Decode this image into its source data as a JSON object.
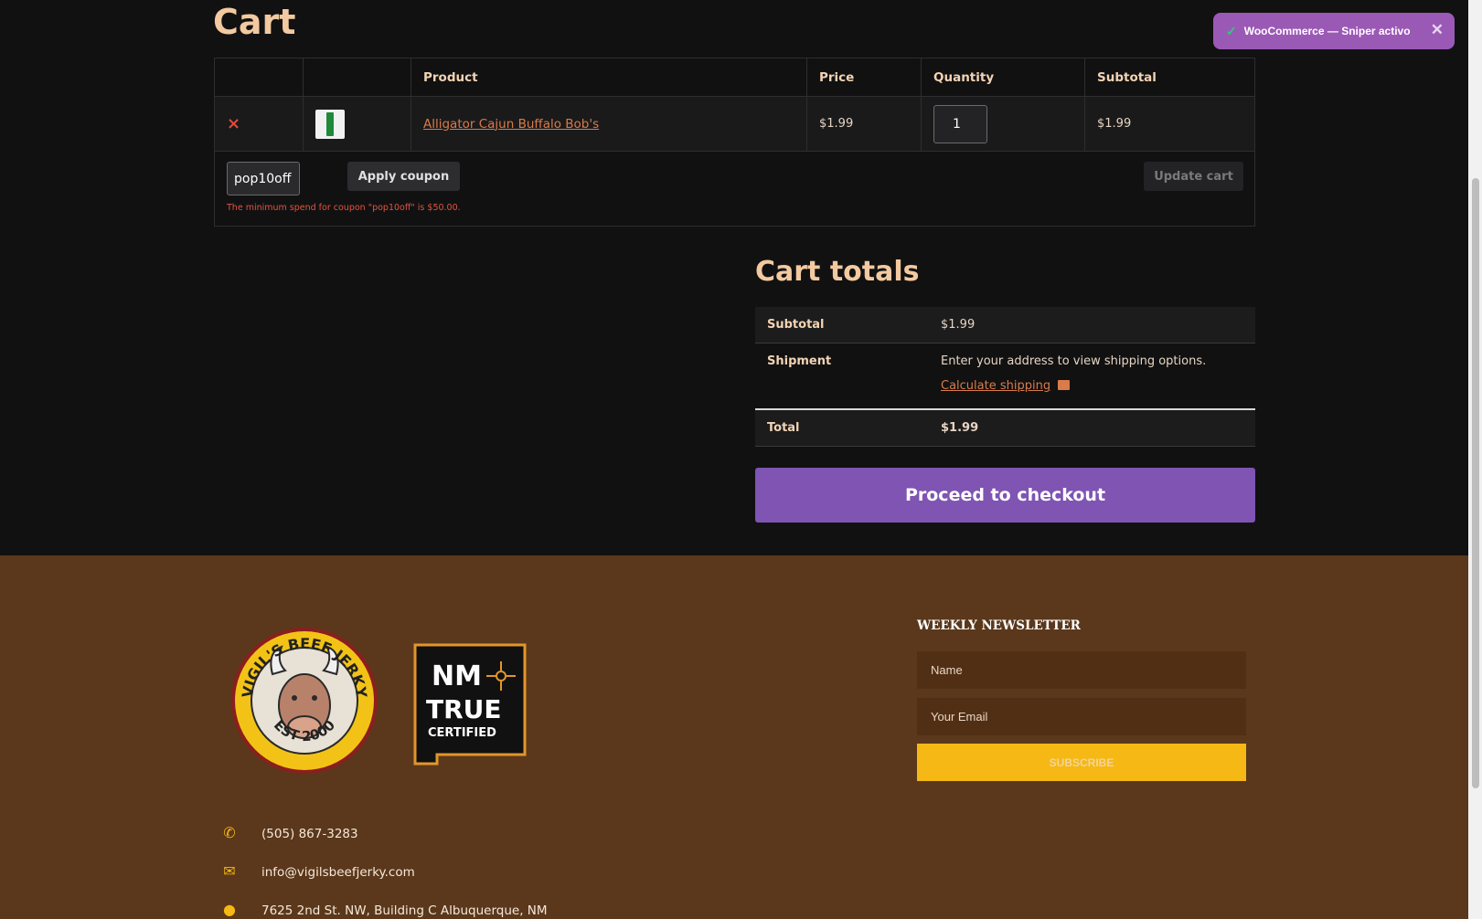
{
  "cart": {
    "title": "Cart",
    "columns": [
      "",
      "",
      "Product",
      "Price",
      "Quantity",
      "Subtotal"
    ],
    "items": [
      {
        "remove_icon": "×",
        "product_name": "Alligator Cajun Buffalo Bob's",
        "price": "$1.99",
        "quantity": "1",
        "subtotal": "$1.99"
      }
    ],
    "coupon": {
      "value": "pop10off",
      "apply_label": "Apply coupon",
      "error": "The minimum spend for coupon \"pop10off\" is $50.00."
    },
    "update_label": "Update cart"
  },
  "totals": {
    "title": "Cart totals",
    "subtotal_label": "Subtotal",
    "subtotal_value": "$1.99",
    "shipment_label": "Shipment",
    "shipment_text": "Enter your address to view shipping options.",
    "calculate_link": "Calculate shipping",
    "total_label": "Total",
    "total_value": "$1.99",
    "checkout_label": "Proceed to checkout"
  },
  "footer": {
    "logo_bull": {
      "text": "VIGIL'S BEEF JERKY",
      "est": "EST 2000"
    },
    "logo_nm": {
      "line1": "NM",
      "line2": "TRUE",
      "line3": "CERTIFIED"
    },
    "newsletter": {
      "title": "WEEKLY NEWSLETTER",
      "name_placeholder": "Name",
      "email_placeholder": "Your Email",
      "subscribe_label": "SUBSCRIBE"
    },
    "contact": {
      "phone": "(505) 867-3283",
      "email": "info@vigilsbeefjerky.com",
      "address": "7625 2nd St. NW, Building C Albuquerque, NM"
    }
  },
  "toast": {
    "text": "WooCommerce — Sniper activo",
    "check_icon": "✓",
    "close_icon": "✕"
  },
  "colors": {
    "accent_purple": "#7f54b3",
    "footer_brown": "#5b381b",
    "subscribe_yellow": "#f5b814",
    "link_orange": "#d97b4a",
    "error_red": "#e5533f"
  }
}
